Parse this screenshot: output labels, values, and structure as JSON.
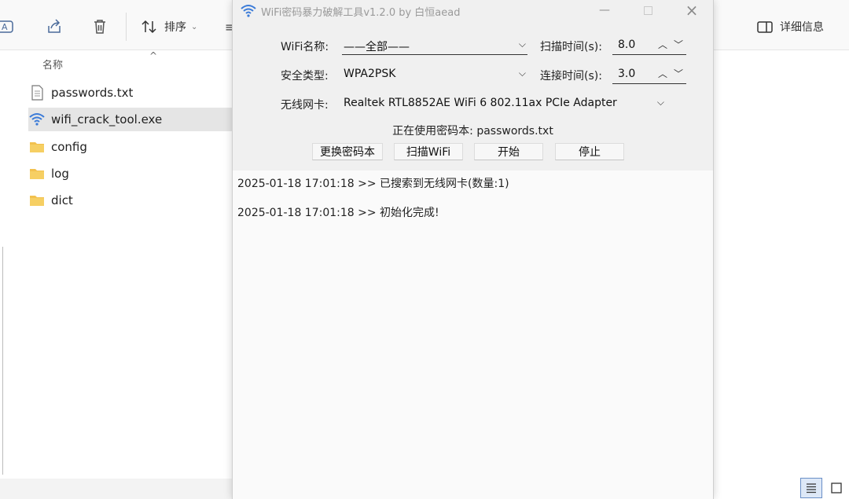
{
  "explorer": {
    "toolbar": {
      "sort_label": "排序",
      "details_label": "详细信息"
    },
    "column_header": "名称",
    "files": [
      {
        "name": "passwords.txt",
        "icon": "text-file-icon"
      },
      {
        "name": "wifi_crack_tool.exe",
        "icon": "wifi-app-icon"
      },
      {
        "name": "config",
        "icon": "folder-icon"
      },
      {
        "name": "log",
        "icon": "folder-icon"
      },
      {
        "name": "dict",
        "icon": "folder-icon"
      }
    ],
    "selected_file": "wifi_crack_tool.exe"
  },
  "tool": {
    "title": "WiFi密码暴力破解工具v1.2.0 by 白恒aead",
    "wifi_name_label": "WiFi名称:",
    "wifi_name_value": "——全部——",
    "scan_time_label": "扫描时间(s):",
    "scan_time_value": "8.0",
    "security_label": "安全类型:",
    "security_value": "WPA2PSK",
    "connect_time_label": "连接时间(s):",
    "connect_time_value": "3.0",
    "nic_label": "无线网卡:",
    "nic_value": "Realtek RTL8852AE WiFi 6 802.11ax PCIe Adapter",
    "dict_status": "正在使用密码本: passwords.txt",
    "buttons": {
      "change_dict": "更换密码本",
      "scan_wifi": "扫描WiFi",
      "start": "开始",
      "stop": "停止"
    },
    "log": [
      "2025-01-18 17:01:18 >> 已搜索到无线网卡(数量:1)",
      "2025-01-18 17:01:18 >> 初始化完成!"
    ]
  },
  "colors": {
    "wifi_icon_blue": "#3b7bd8",
    "folder_yellow": "#f2c14e",
    "selection_gray": "#e5e5e5"
  }
}
